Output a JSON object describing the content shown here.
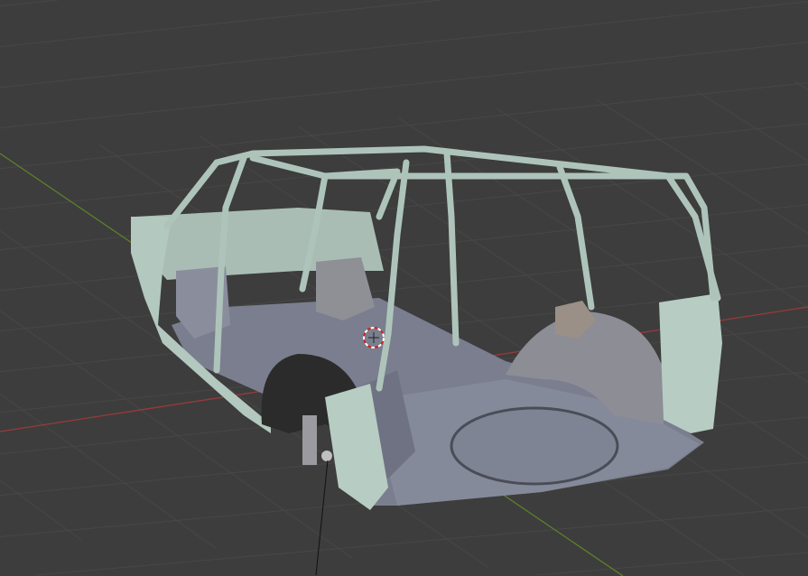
{
  "viewport": {
    "background": "#3d3d3d",
    "grid_color": "#474747",
    "x_axis_color": "#9a3a3a",
    "y_axis_color": "#5f7f2a",
    "body_color": "#b8cdc4",
    "floor_color": "#7d8191",
    "wheel_arch_color": "#2a2a2a",
    "cursor_icon": "3d-cursor-icon"
  }
}
